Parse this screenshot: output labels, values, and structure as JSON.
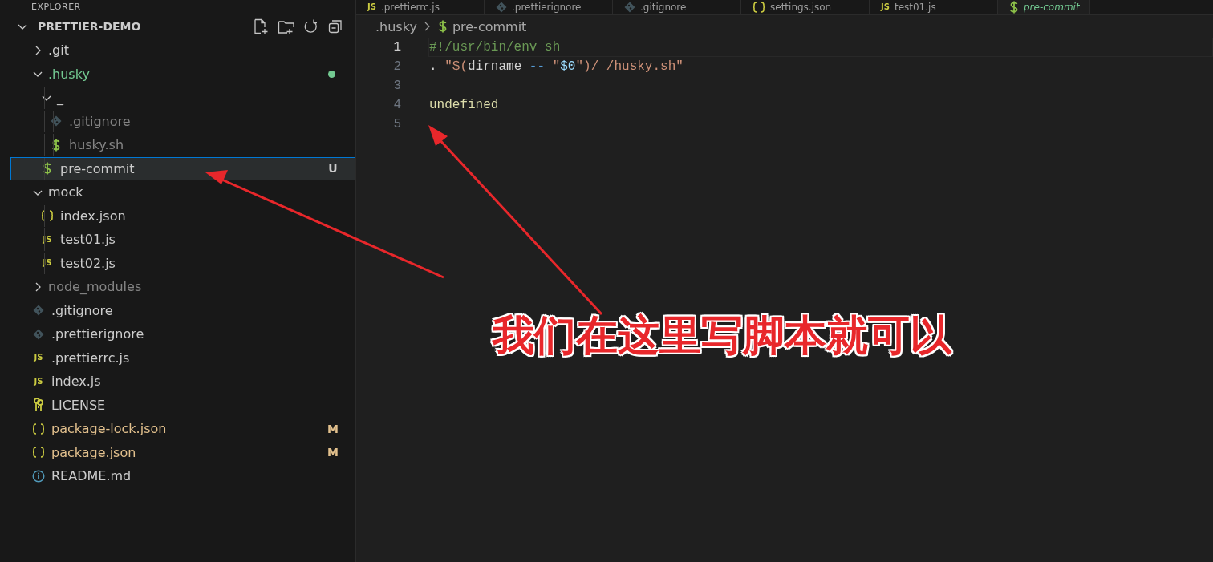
{
  "sidebar": {
    "title": "EXPLORER",
    "section": {
      "label": "PRETTIER-DEMO",
      "expanded": true
    },
    "tree": [
      {
        "name": ".git",
        "kind": "folder",
        "expanded": false,
        "selected": false,
        "dimmed": false
      },
      {
        "name": ".husky",
        "kind": "folder",
        "expanded": true,
        "selected": false,
        "dimmed": false,
        "color": "#73c991",
        "dot": true,
        "children": [
          {
            "name": "_",
            "kind": "folder",
            "expanded": true,
            "selected": false,
            "dimmed": false,
            "children": [
              {
                "name": ".gitignore",
                "kind": "git",
                "selected": false,
                "dimmed": true
              },
              {
                "name": "husky.sh",
                "kind": "shell",
                "selected": false,
                "dimmed": true
              }
            ]
          },
          {
            "name": "pre-commit",
            "kind": "shell",
            "selected": true,
            "dimmed": false,
            "badge": "U"
          }
        ]
      },
      {
        "name": "mock",
        "kind": "folder",
        "expanded": true,
        "selected": false,
        "dimmed": false,
        "children": [
          {
            "name": "index.json",
            "kind": "json",
            "selected": false,
            "dimmed": false
          },
          {
            "name": "test01.js",
            "kind": "js",
            "icon_text": "JS",
            "selected": false,
            "dimmed": false
          },
          {
            "name": "test02.js",
            "kind": "js",
            "icon_text": "JS",
            "selected": false,
            "dimmed": false
          }
        ]
      },
      {
        "name": "node_modules",
        "kind": "folder",
        "expanded": false,
        "selected": false,
        "dimmed": true
      },
      {
        "name": ".gitignore",
        "kind": "git",
        "selected": false,
        "dimmed": false
      },
      {
        "name": ".prettierignore",
        "kind": "git",
        "selected": false,
        "dimmed": false
      },
      {
        "name": ".prettierrc.js",
        "kind": "js",
        "icon_text": "JS",
        "selected": false,
        "dimmed": false
      },
      {
        "name": "index.js",
        "kind": "js",
        "icon_text": "JS",
        "selected": false,
        "dimmed": false
      },
      {
        "name": "LICENSE",
        "kind": "license",
        "selected": false,
        "dimmed": false
      },
      {
        "name": "package-lock.json",
        "kind": "json",
        "selected": false,
        "dimmed": false,
        "color": "#e2c08d",
        "badge": "M"
      },
      {
        "name": "package.json",
        "kind": "json",
        "selected": false,
        "dimmed": false,
        "color": "#e2c08d",
        "badge": "M"
      },
      {
        "name": "README.md",
        "kind": "info",
        "selected": false,
        "dimmed": false
      }
    ]
  },
  "tabs": [
    {
      "label": ".prettierrc.js",
      "kind": "js",
      "icon_text": "JS",
      "selected": false
    },
    {
      "label": ".prettierignore",
      "kind": "git",
      "selected": false
    },
    {
      "label": ".gitignore",
      "kind": "git",
      "selected": false
    },
    {
      "label": "settings.json",
      "kind": "json",
      "selected": false
    },
    {
      "label": "test01.js",
      "kind": "js",
      "icon_text": "JS",
      "selected": false
    },
    {
      "label": "pre-commit",
      "kind": "shell",
      "selected": true
    }
  ],
  "breadcrumb": [
    {
      "label": ".husky",
      "kind": "folder"
    },
    {
      "label": "pre-commit",
      "kind": "shell"
    }
  ],
  "editor": {
    "lines": [
      {
        "number": "1",
        "current": true,
        "tokens": [
          {
            "text": "#!/usr/bin/env sh",
            "kind": "comment"
          }
        ]
      },
      {
        "number": "2",
        "current": false,
        "tokens": [
          {
            "text": ". ",
            "kind": "plain"
          },
          {
            "text": "\"$(",
            "kind": "string"
          },
          {
            "text": "dirname",
            "kind": "plain"
          },
          {
            "text": " -- ",
            "kind": "operator"
          },
          {
            "text": "\"",
            "kind": "string"
          },
          {
            "text": "$0",
            "kind": "variable"
          },
          {
            "text": "\")/_/husky.sh\"",
            "kind": "string"
          }
        ]
      },
      {
        "number": "3",
        "current": false
      },
      {
        "number": "4",
        "current": false,
        "tokens": [
          {
            "text": "undefined",
            "kind": "function"
          }
        ]
      },
      {
        "number": "5",
        "current": false
      }
    ]
  },
  "annotation": {
    "text": "我们在这里写脚本就可以"
  }
}
